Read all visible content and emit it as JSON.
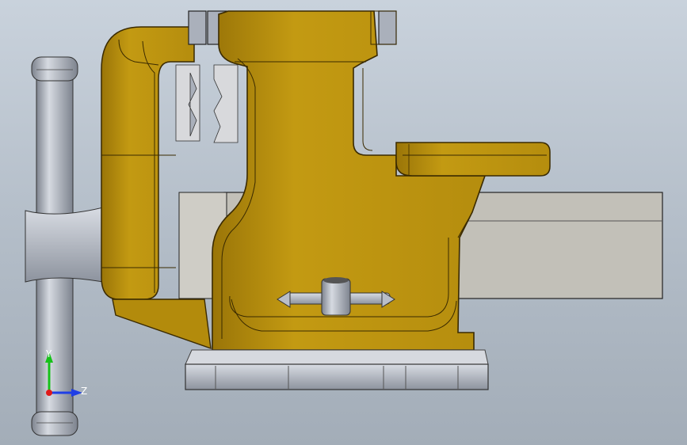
{
  "viewport": {
    "colors": {
      "bg_top": "#c9d2dc",
      "bg_bottom": "#a3adb8"
    }
  },
  "model": {
    "parts": [
      "bench-vise-body",
      "sliding-jaw",
      "t-handle",
      "spindle-pin",
      "swivel-base",
      "workpiece-bar"
    ],
    "colors": {
      "body": "#c39a12",
      "body_shade": "#9a7508",
      "edge": "#3a2a00",
      "steel": "#b9bec8",
      "steel_dark": "#7d838e",
      "bar": "#c2c0b8",
      "jaw_plate": "#aab0bb"
    }
  },
  "triad": {
    "y_label": "Y",
    "z_label": "Z",
    "colors": {
      "y": "#17c11a",
      "z": "#1f3fe6",
      "x": "#e01a1a"
    }
  }
}
